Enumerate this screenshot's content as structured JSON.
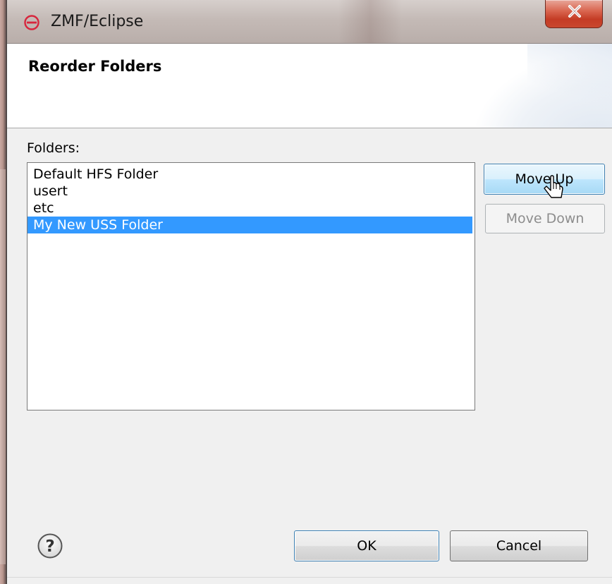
{
  "window": {
    "title": "ZMF/Eclipse",
    "app_icon": "zmf-logo-icon",
    "close_icon": "close-icon"
  },
  "banner": {
    "title": "Reorder Folders"
  },
  "folders": {
    "label": "Folders:",
    "items": [
      {
        "label": "Default HFS Folder",
        "selected": false
      },
      {
        "label": "usert",
        "selected": false
      },
      {
        "label": "etc",
        "selected": false
      },
      {
        "label": "My New USS Folder",
        "selected": true
      }
    ],
    "move_up_label": "Move Up",
    "move_down_label": "Move Down",
    "move_down_enabled": false
  },
  "footer": {
    "help_icon": "help-icon",
    "ok_label": "OK",
    "cancel_label": "Cancel"
  },
  "colors": {
    "selection": "#3399ff",
    "close_button": "#c43c25",
    "app_icon": "#d7263d"
  }
}
